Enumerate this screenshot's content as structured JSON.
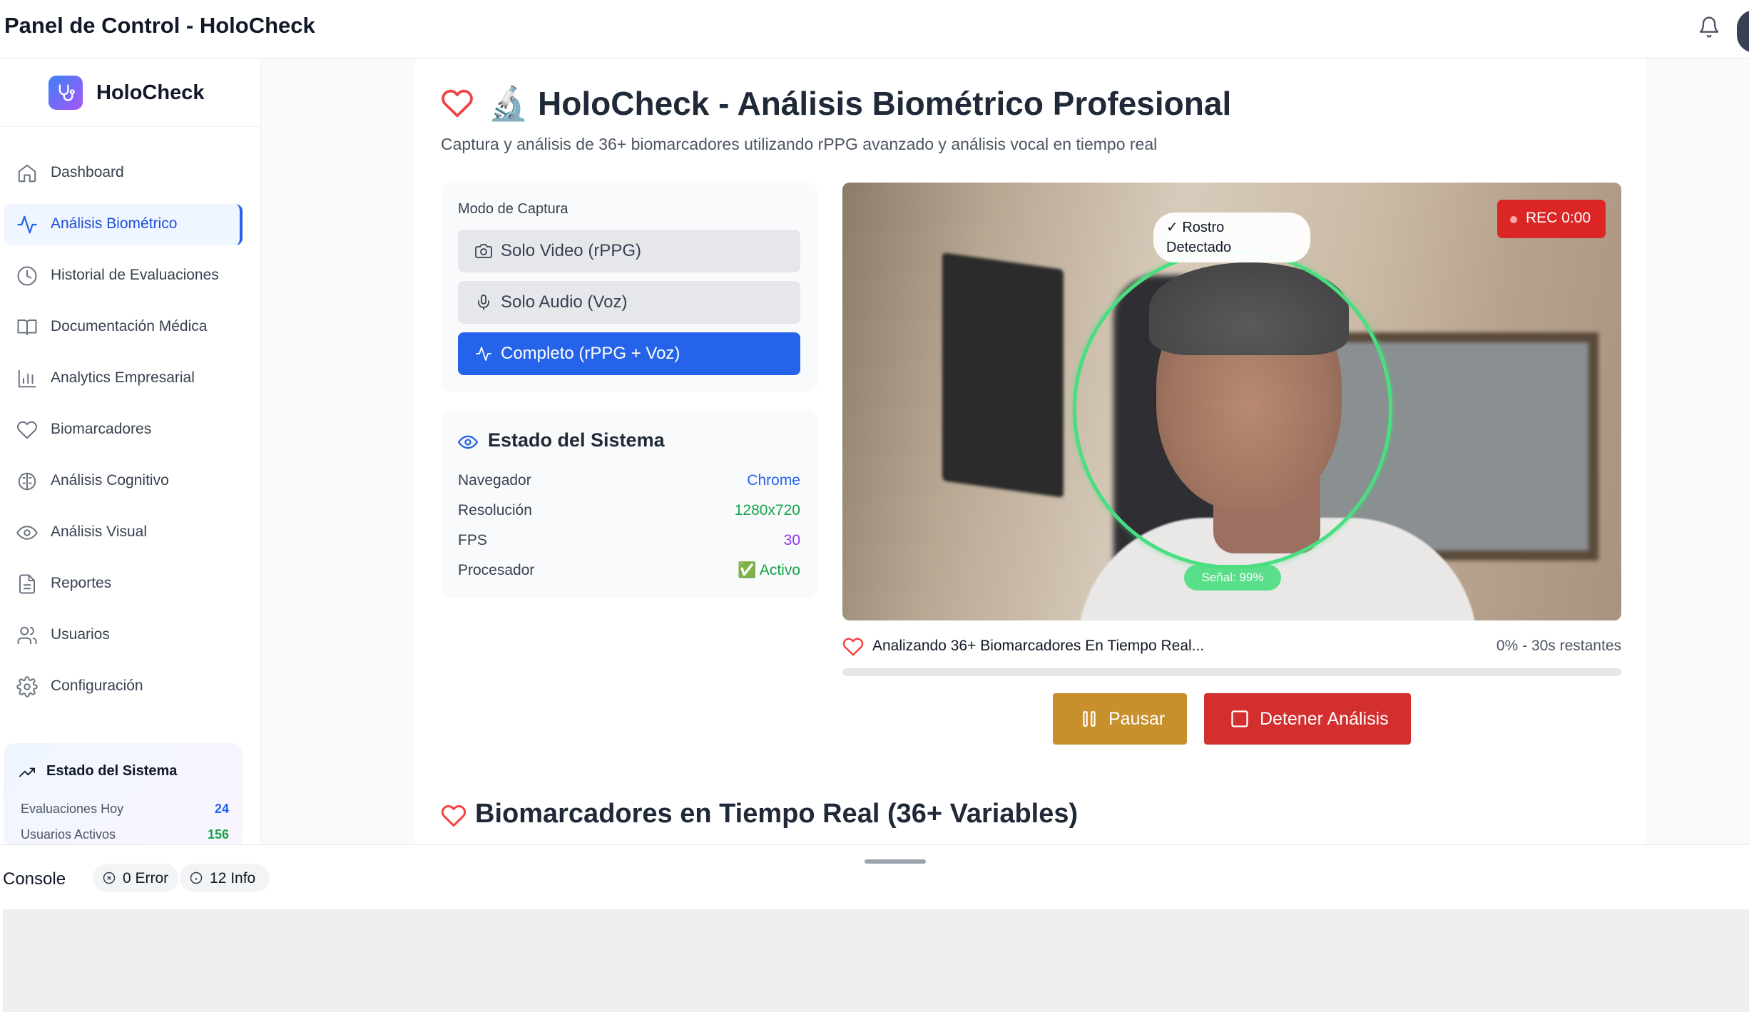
{
  "topbar": {
    "title": "Panel de Control - HoloCheck",
    "icons": [
      "bell-icon",
      "avatar"
    ]
  },
  "sidebar": {
    "brand": "HoloCheck",
    "items": [
      {
        "label": "Dashboard",
        "icon": "home-icon",
        "active": false
      },
      {
        "label": "Análisis Biométrico",
        "icon": "activity-icon",
        "active": true
      },
      {
        "label": "Historial de Evaluaciones",
        "icon": "clock-icon",
        "active": false
      },
      {
        "label": "Documentación Médica",
        "icon": "book-icon",
        "active": false
      },
      {
        "label": "Analytics Empresarial",
        "icon": "bar-chart-icon",
        "active": false
      },
      {
        "label": "Biomarcadores",
        "icon": "heart-icon",
        "active": false
      },
      {
        "label": "Análisis Cognitivo",
        "icon": "brain-icon",
        "active": false
      },
      {
        "label": "Análisis Visual",
        "icon": "eye-icon",
        "active": false
      },
      {
        "label": "Reportes",
        "icon": "file-icon",
        "active": false
      },
      {
        "label": "Usuarios",
        "icon": "users-icon",
        "active": false
      },
      {
        "label": "Configuración",
        "icon": "gear-icon",
        "active": false
      }
    ],
    "system": {
      "title": "Estado del Sistema",
      "rows": [
        {
          "label": "Evaluaciones Hoy",
          "value": "24",
          "color": "#2563eb"
        },
        {
          "label": "Usuarios Activos",
          "value": "156",
          "color": "#16a34a"
        }
      ]
    }
  },
  "main": {
    "title": "🔬 HoloCheck - Análisis Biométrico Profesional",
    "subtitle": "Captura y análisis de 36+ biomarcadores utilizando rPPG avanzado y análisis vocal en tiempo real",
    "capture": {
      "label": "Modo de Captura",
      "modes": [
        {
          "label": "Solo Video (rPPG)",
          "icon": "camera-icon",
          "selected": false
        },
        {
          "label": "Solo Audio (Voz)",
          "icon": "mic-icon",
          "selected": false
        },
        {
          "label": "Completo (rPPG + Voz)",
          "icon": "activity-icon",
          "selected": true
        }
      ]
    },
    "status": {
      "title": "Estado del Sistema",
      "rows": [
        {
          "label": "Navegador",
          "value": "Chrome",
          "color": "#2563eb"
        },
        {
          "label": "Resolución",
          "value": "1280x720",
          "color": "#16a34a"
        },
        {
          "label": "FPS",
          "value": "30",
          "color": "#9333ea"
        },
        {
          "label": "Procesador",
          "value": "✅ Activo",
          "color": "#16a34a"
        }
      ]
    },
    "video": {
      "face_tag_line1": "✓ Rostro",
      "face_tag_line2": "Detectado",
      "rec": "REC 0:00",
      "signal": "Señal: 99%"
    },
    "progress": {
      "label": "Analizando 36+ Biomarcadores En Tiempo Real...",
      "right": "0% - 30s restantes",
      "percent": 0
    },
    "buttons": {
      "pause": "Pausar",
      "stop": "Detener Análisis"
    },
    "section2_title": "Biomarcadores en Tiempo Real (36+ Variables)"
  },
  "console": {
    "label": "Console",
    "errors": "0 Error",
    "info": "12 Info"
  }
}
